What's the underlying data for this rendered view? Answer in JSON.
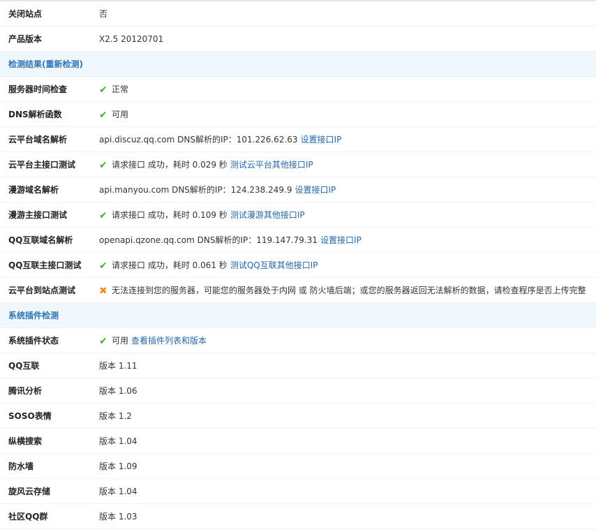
{
  "rows_top": [
    {
      "label": "关闭站点",
      "value": "否"
    },
    {
      "label": "产品版本",
      "value": "X2.5 20120701"
    }
  ],
  "section_check": {
    "title": "检测结果(重新检测)"
  },
  "checks": {
    "server_time": {
      "label": "服务器时间检查",
      "status": "正常"
    },
    "dns_func": {
      "label": "DNS解析函数",
      "status": "可用"
    },
    "cloud_domain": {
      "label": "云平台域名解析",
      "text": "api.discuz.qq.com DNS解析的IP：101.226.62.63",
      "link": "设置接口IP"
    },
    "cloud_api": {
      "label": "云平台主接口测试",
      "text": "请求接口 成功，耗时 0.029 秒",
      "link": "测试云平台其他接口IP"
    },
    "manyou_domain": {
      "label": "漫游域名解析",
      "text": "api.manyou.com DNS解析的IP：124.238.249.9",
      "link": "设置接口IP"
    },
    "manyou_api": {
      "label": "漫游主接口测试",
      "text": "请求接口 成功，耗时 0.109 秒",
      "link": "测试漫游其他接口IP"
    },
    "qq_domain": {
      "label": "QQ互联域名解析",
      "text": "openapi.qzone.qq.com DNS解析的IP：119.147.79.31",
      "link": "设置接口IP"
    },
    "qq_api": {
      "label": "QQ互联主接口测试",
      "text": "请求接口 成功，耗时 0.061 秒",
      "link": "测试QQ互联其他接口IP"
    },
    "cloud_site": {
      "label": "云平台到站点测试",
      "text": "无法连接到您的服务器，可能您的服务器处于内网 或 防火墙后端；或您的服务器返回无法解析的数据，请检查程序是否上传完整"
    }
  },
  "section_plugins": {
    "title": "系统插件检测"
  },
  "plugin_status": {
    "label": "系统插件状态",
    "status": "可用",
    "link": "查看插件列表和版本"
  },
  "plugins": [
    {
      "label": "QQ互联",
      "value": "版本 1.11"
    },
    {
      "label": "腾讯分析",
      "value": "版本 1.06"
    },
    {
      "label": "SOSO表情",
      "value": "版本 1.2"
    },
    {
      "label": "纵横搜索",
      "value": "版本 1.04"
    },
    {
      "label": "防水墙",
      "value": "版本 1.09"
    },
    {
      "label": "旋风云存储",
      "value": "版本 1.04"
    },
    {
      "label": "社区QQ群",
      "value": "版本 1.03"
    }
  ],
  "icons": {
    "ok": "check-icon",
    "error": "cross-icon"
  },
  "colors": {
    "link": "#2366a8",
    "section_bg": "#f0f7fd",
    "section_text": "#2d76b4",
    "ok": "#50a830",
    "error": "#f08c1c"
  }
}
